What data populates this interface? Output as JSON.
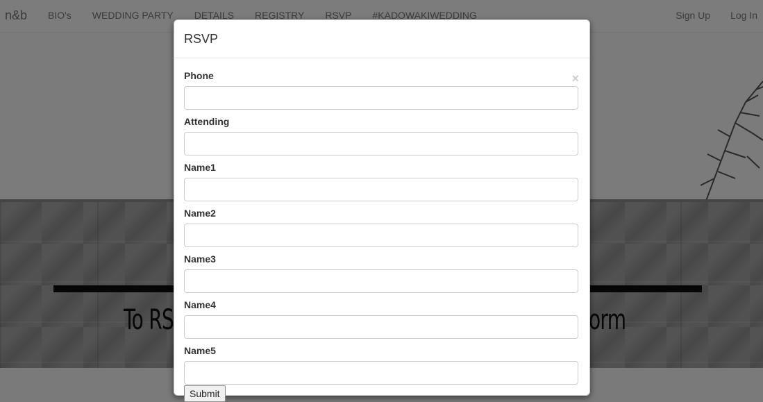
{
  "navbar": {
    "brand": "n&b",
    "items": [
      {
        "label": "BIO's"
      },
      {
        "label": "WEDDING PARTY"
      },
      {
        "label": "DETAILS"
      },
      {
        "label": "REGISTRY"
      },
      {
        "label": "RSVP"
      },
      {
        "label": "#KADOWAKIWEDDING"
      }
    ],
    "sign_up": "Sign Up",
    "log_in": "Log In"
  },
  "hero": {
    "text_left": "To RS",
    "text_right": "orm"
  },
  "modal": {
    "title": "RSVP",
    "close_label": "×",
    "fields": [
      {
        "label": "Phone",
        "value": ""
      },
      {
        "label": "Attending",
        "value": ""
      },
      {
        "label": "Name1",
        "value": ""
      },
      {
        "label": "Name2",
        "value": ""
      },
      {
        "label": "Name3",
        "value": ""
      },
      {
        "label": "Name4",
        "value": ""
      },
      {
        "label": "Name5",
        "value": ""
      }
    ],
    "submit_label": "Submit"
  }
}
